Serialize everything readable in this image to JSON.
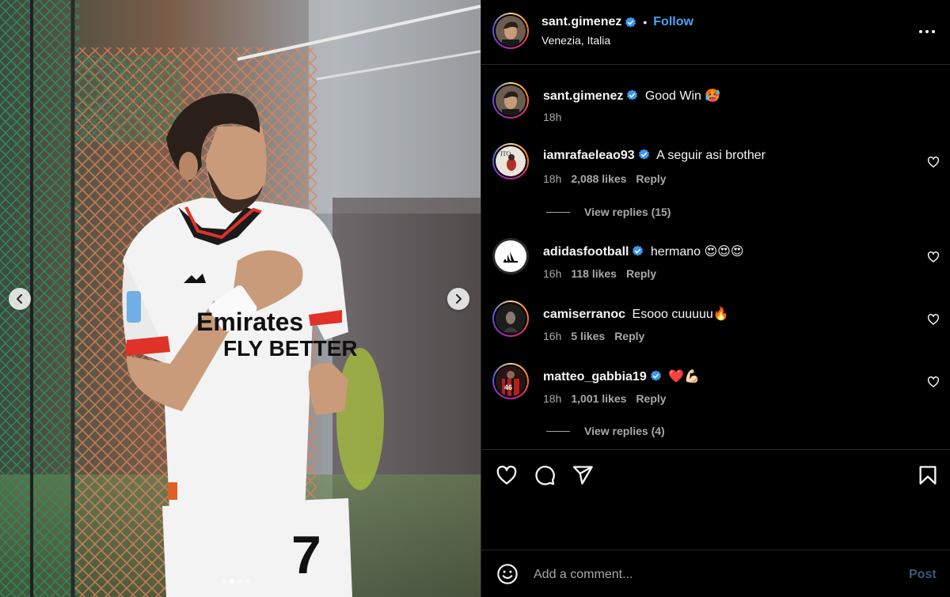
{
  "post": {
    "author": "sant.gimenez",
    "follow_label": "Follow",
    "separator": "•",
    "location": "Venezia, Italia",
    "caption": "Good Win 🥵",
    "caption_time": "18h"
  },
  "media": {
    "slide_count": 4,
    "active_slide": 1,
    "shirt_sponsor_lines": [
      "Emirates",
      "FLY BETTER"
    ],
    "shirt_number": "7"
  },
  "comments": [
    {
      "username": "iamrafaeleao93",
      "verified": true,
      "text": "A seguir asi brother",
      "time": "18h",
      "likes": "2,088 likes",
      "reply_label": "Reply",
      "view_replies": "View replies (15)"
    },
    {
      "username": "adidasfootball",
      "verified": true,
      "text": "hermano 😍😍😍",
      "time": "16h",
      "likes": "118 likes",
      "reply_label": "Reply",
      "view_replies": null
    },
    {
      "username": "camiserranoc",
      "verified": false,
      "text": "Esooo cuuuuu🔥",
      "time": "16h",
      "likes": "5 likes",
      "reply_label": "Reply",
      "view_replies": null
    },
    {
      "username": "matteo_gabbia19",
      "verified": true,
      "text": "❤️💪🏻",
      "time": "18h",
      "likes": "1,001 likes",
      "reply_label": "Reply",
      "view_replies": "View replies (4)"
    }
  ],
  "composer": {
    "placeholder": "Add a comment...",
    "post_label": "Post"
  },
  "icons": [
    "heart-icon",
    "comment-icon",
    "share-icon",
    "bookmark-icon",
    "emoji-icon",
    "more-icon",
    "verified-icon",
    "chevron-left-icon",
    "chevron-right-icon"
  ],
  "colors": {
    "accent": "#4aa3f5",
    "verified": "#3897f0",
    "muted": "#a8a8a8",
    "post_disabled": "#3b5a78"
  }
}
